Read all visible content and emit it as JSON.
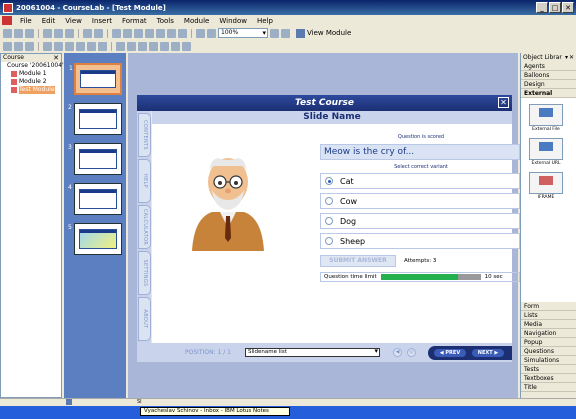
{
  "window": {
    "title": "20061004 - CourseLab - [Test Module]"
  },
  "menu": [
    "File",
    "Edit",
    "View",
    "Insert",
    "Format",
    "Tools",
    "Module",
    "Window",
    "Help"
  ],
  "toolbar": {
    "zoom": "100%",
    "view_module": "View Module"
  },
  "course_panel": {
    "title": "Course",
    "root": "Course '20061004'",
    "modules": [
      "Module 1",
      "Module 2",
      "Test Module"
    ]
  },
  "slides": [
    "1",
    "2",
    "3",
    "4",
    "5"
  ],
  "slide": {
    "course_title": "Test Course",
    "slide_name": "Slide Name",
    "side_tabs": [
      "CONTENTS",
      "HELP",
      "CALCULATOR",
      "SETTINGS",
      "ABOUT"
    ],
    "question_scored": "Question is scored",
    "question": "Meow is the cry of...",
    "select_prompt": "Select correct variant",
    "options": [
      {
        "label": "Cat",
        "checked": true
      },
      {
        "label": "Cow",
        "checked": false
      },
      {
        "label": "Dog",
        "checked": false
      },
      {
        "label": "Sheep",
        "checked": false
      }
    ],
    "submit": "SUBMIT ANSWER",
    "attempts": "Attempts: 3",
    "time_limit_label": "Question time limit",
    "time_value": "10 sec",
    "time_progress": 0.77,
    "position": "POSITION: 1 / 1",
    "slidename_list": "Slidename list",
    "prev": "◀ PREV",
    "next": "NEXT ▶"
  },
  "object_library": {
    "title": "Object Librar",
    "categories_top": [
      "Agents",
      "Balloons",
      "Design",
      "External"
    ],
    "active": "External",
    "items": [
      "External File",
      "External URL",
      "IFRAME"
    ],
    "categories_bottom": [
      "Form",
      "Lists",
      "Media",
      "Navigation",
      "Popup",
      "Questions",
      "Simulations",
      "Tests",
      "Textboxes",
      "Title"
    ]
  },
  "status": {
    "left": "Sl"
  },
  "taskbar": {
    "item": "Vyacheslav Schinov - Inbox - IBM Lotus Notes"
  },
  "colors": {
    "accent": "#1b2f72",
    "timer_fill": "#22b14c",
    "selected_module": "#f0a060"
  }
}
